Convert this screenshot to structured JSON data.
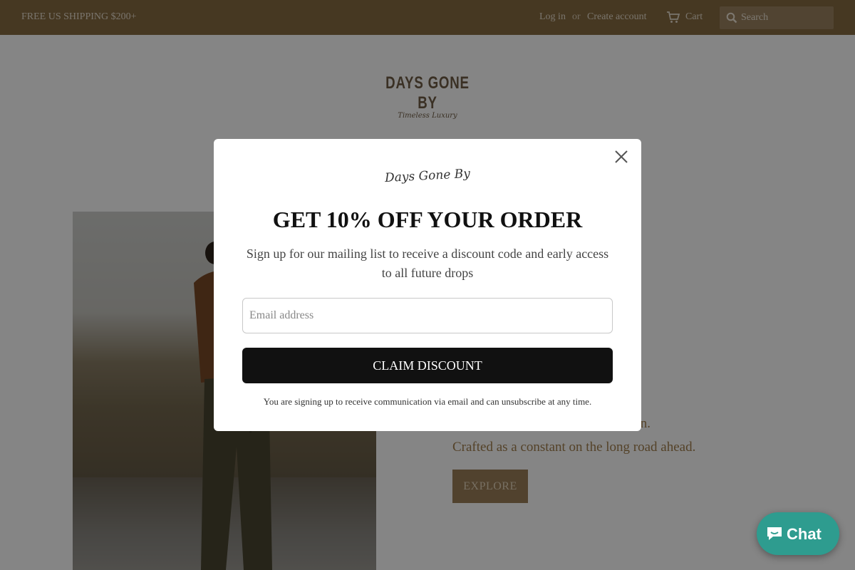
{
  "topbar": {
    "shipping": "FREE US SHIPPING $200+",
    "login": "Log in",
    "or": "or",
    "create_account": "Create account",
    "cart": "Cart",
    "search_label": "SEARCH",
    "search_placeholder": "Search"
  },
  "logo": {
    "brand": "DAYS GONE BY",
    "tagline": "Timeless Luxury"
  },
  "hero": {
    "line1": "ain.",
    "line2": "Crafted as a constant on the long road ahead.",
    "explore_label": "EXPLORE"
  },
  "modal": {
    "logo": "Days Gone By",
    "headline": "GET 10% OFF YOUR ORDER",
    "description": "Sign up for our mailing list to receive a discount code and early access to all future drops",
    "email_placeholder": "Email address",
    "cta": "CLAIM DISCOUNT",
    "fine_print": "You are signing up to receive communication via email and can unsubscribe at any time."
  },
  "chat": {
    "label": "Chat"
  },
  "colors": {
    "topbar": "#876c42",
    "accent_text": "#a27f4e",
    "cta": "#111111",
    "chat": "#2e9c8f"
  },
  "icons": [
    "cart-icon",
    "search-icon",
    "close-icon",
    "chat-bubble-icon"
  ]
}
